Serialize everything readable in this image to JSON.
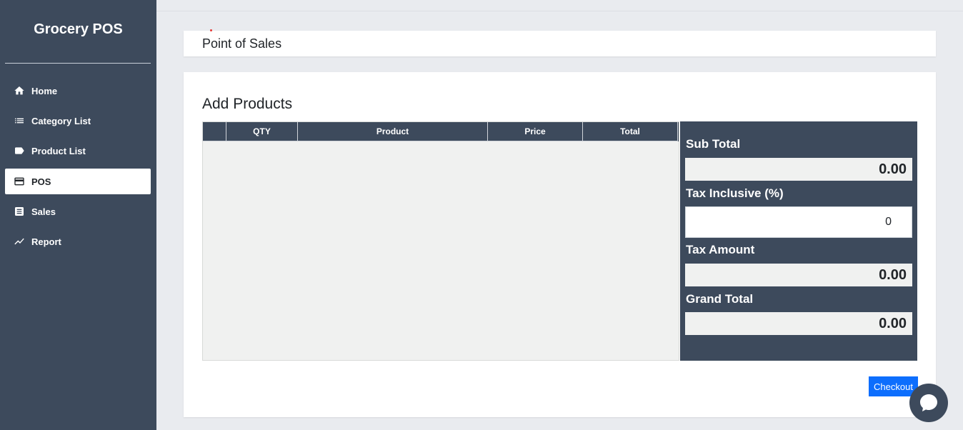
{
  "sidebar": {
    "brand": "Grocery POS",
    "items": [
      {
        "label": "Home",
        "icon": "home-icon"
      },
      {
        "label": "Category List",
        "icon": "list-icon"
      },
      {
        "label": "Product List",
        "icon": "tag-icon"
      },
      {
        "label": "POS",
        "icon": "card-icon",
        "active": true
      },
      {
        "label": "Sales",
        "icon": "receipt-icon"
      },
      {
        "label": "Report",
        "icon": "trending-icon"
      }
    ]
  },
  "header": {
    "title": "Point of Sales"
  },
  "main": {
    "section_title": "Add Products",
    "table": {
      "columns": [
        "",
        "QTY",
        "Product",
        "Price",
        "Total"
      ],
      "rows": []
    },
    "summary": {
      "sub_total_label": "Sub Total",
      "sub_total_value": "0.00",
      "tax_label": "Tax Inclusive (%)",
      "tax_value": "0",
      "tax_amount_label": "Tax Amount",
      "tax_amount_value": "0.00",
      "grand_total_label": "Grand Total",
      "grand_total_value": "0.00"
    },
    "checkout_label": "Checkout"
  },
  "colors": {
    "sidebar": "#3d4a5c",
    "accent": "#0d6efd",
    "background": "#e9ebef"
  }
}
